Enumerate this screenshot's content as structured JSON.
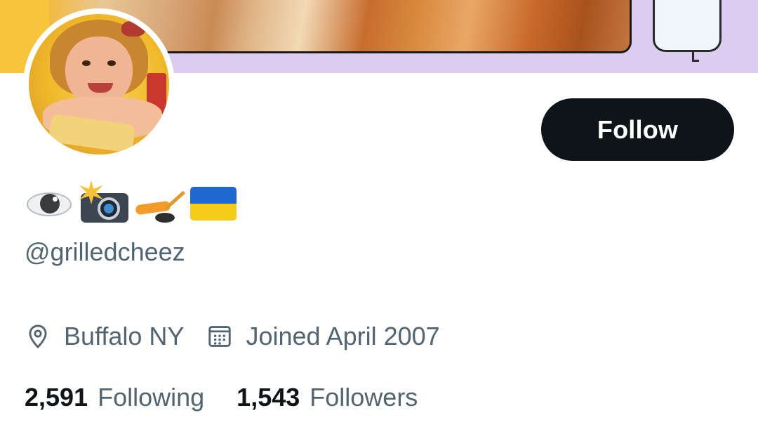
{
  "profile": {
    "display_name_emojis": [
      "eye",
      "camera-with-flash",
      "ice-hockey",
      "flag-ukraine"
    ],
    "handle": "@grilledcheez",
    "follow_button_label": "Follow",
    "location": "Buffalo NY",
    "joined": "Joined April 2007",
    "following_count": "2,591",
    "following_label": "Following",
    "followers_count": "1,543",
    "followers_label": "Followers"
  },
  "icons": {
    "location": "location-pin-icon",
    "joined": "calendar-icon"
  },
  "colors": {
    "button_bg": "#0f1419",
    "secondary_text": "#536471",
    "banner_bg": "#dccdf0"
  }
}
